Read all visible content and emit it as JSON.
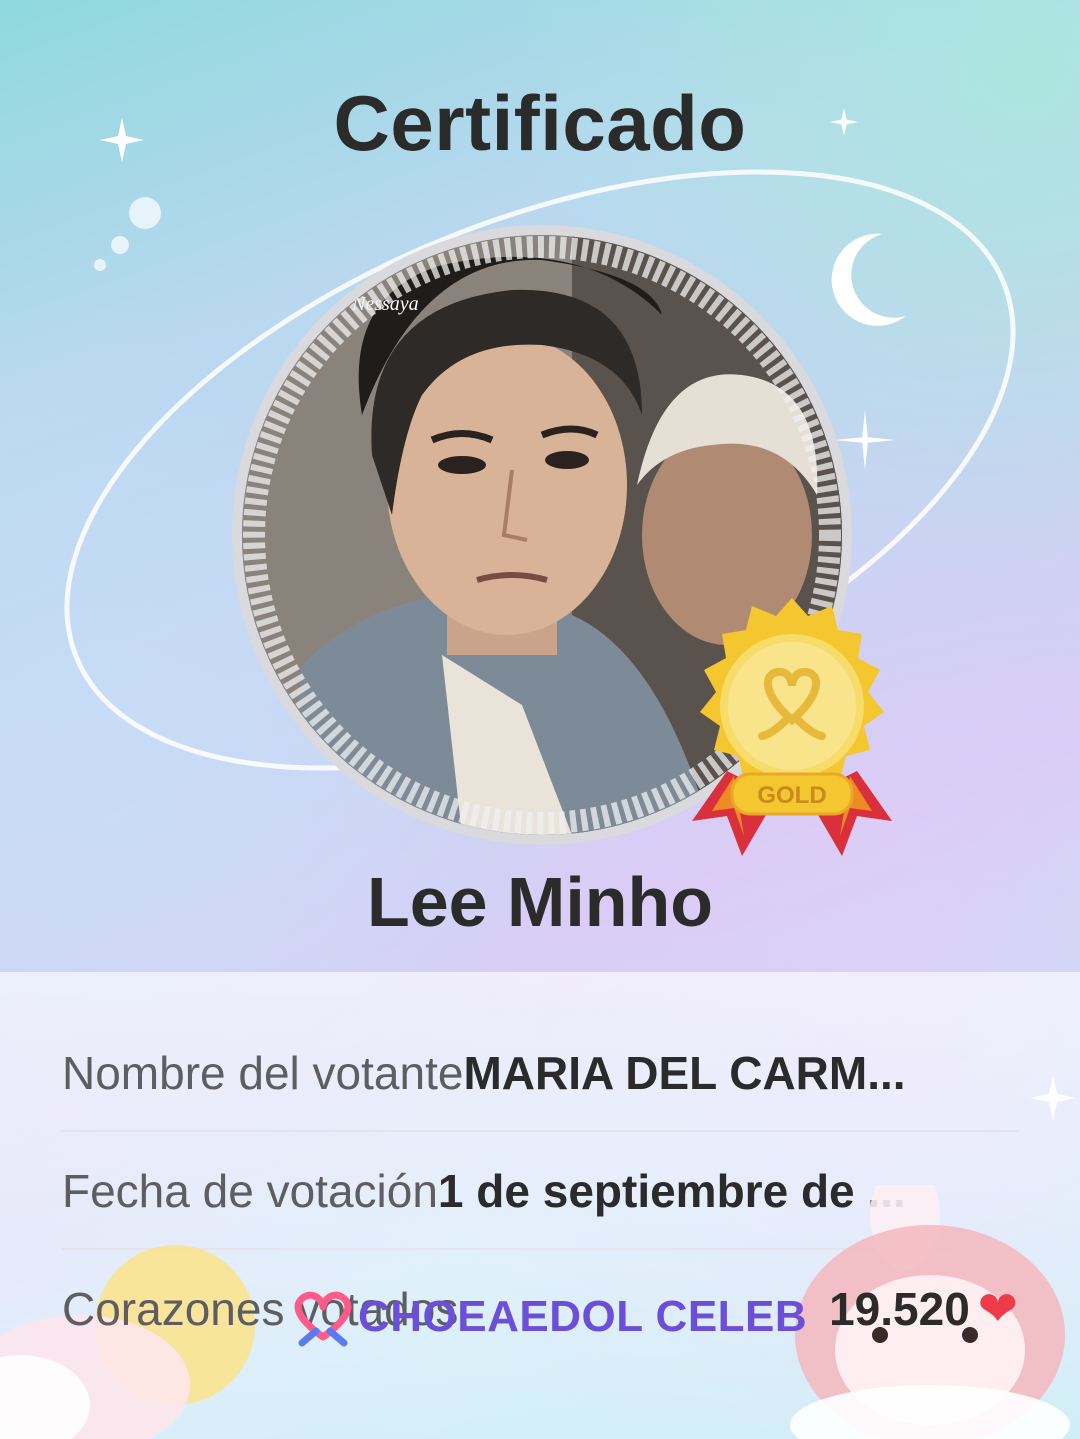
{
  "certificate": {
    "title": "Certificado",
    "celebrity_name": "Lee Minho",
    "medal_label": "GOLD",
    "photo_watermark": "Nessaya"
  },
  "details": {
    "voter_label": "Nombre del votante",
    "voter_value": "MARIA DEL CARM...",
    "date_label": "Fecha de votación",
    "date_value": "1 de septiembre de ...",
    "hearts_label": "Corazones votados",
    "hearts_value": "19.520"
  },
  "brand": {
    "name": "CHOEAEDOL CELEB"
  },
  "colors": {
    "title": "#2b2b2b",
    "brand": "#6b4fd8",
    "heart": "#ee3a4a",
    "medal_gold": "#f4c62f"
  },
  "icons": [
    "sparkle-icon",
    "moon-icon",
    "gold-medal-icon",
    "heart-icon",
    "choeaedol-logo-icon"
  ]
}
